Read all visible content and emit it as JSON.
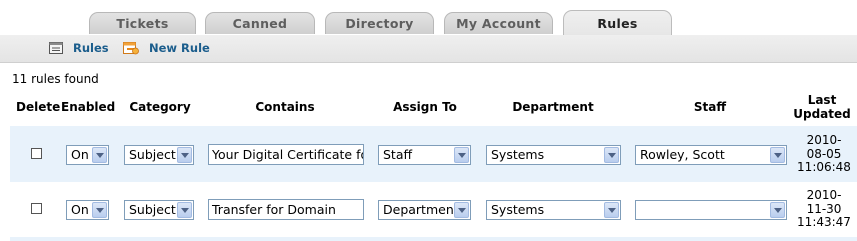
{
  "tabs": [
    {
      "label": "Tickets"
    },
    {
      "label": "Canned Replies"
    },
    {
      "label": "Directory"
    },
    {
      "label": "My Account"
    },
    {
      "label": "Rules",
      "active": true
    }
  ],
  "subnav": {
    "rules_label": "Rules",
    "new_rule_label": "New Rule",
    "rules_icon": "list-window-icon",
    "new_rule_icon": "new-rule-icon"
  },
  "summary": "11 rules found",
  "columns": [
    "Delete",
    "Enabled",
    "Category",
    "Contains",
    "Assign To",
    "Department",
    "Staff",
    "Last Updated"
  ],
  "rows": [
    {
      "enabled": "On",
      "category": "Subject",
      "contains": "Your Digital Certificate for",
      "assign_to": "Staff",
      "department": "Systems",
      "staff": "Rowley, Scott",
      "updated": [
        "2010-",
        "08-05",
        "11:06:48"
      ]
    },
    {
      "enabled": "On",
      "category": "Subject",
      "contains": "Transfer for Domain",
      "assign_to": "Department",
      "department": "Systems",
      "staff": "",
      "updated": [
        "2010-",
        "11-30",
        "11:43:47"
      ]
    }
  ],
  "colors": {
    "row_highlight": "#e8f2fb",
    "link": "#1b5d8c"
  }
}
